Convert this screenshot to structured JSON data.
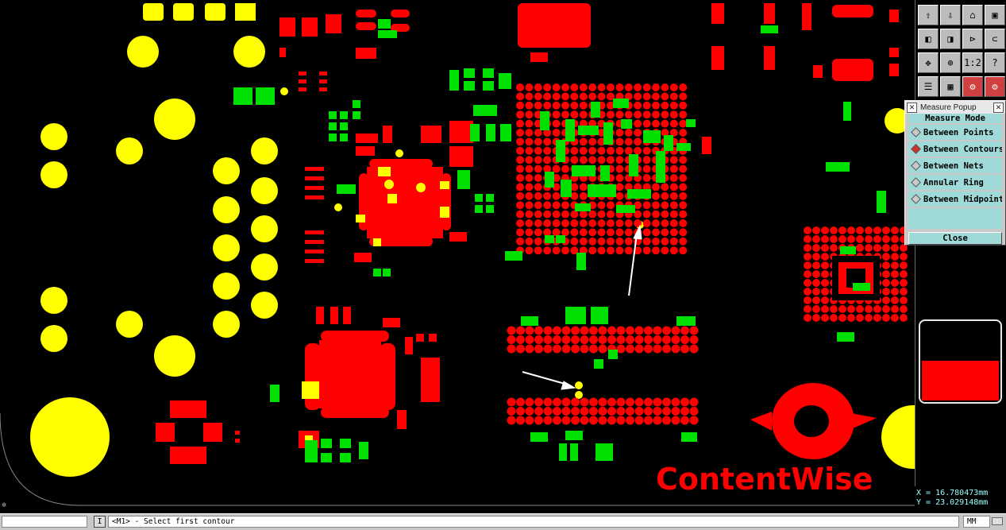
{
  "board": {
    "logo_text": "ContentWise",
    "colors": {
      "copper": "#ff0000",
      "pad": "#ffff00",
      "selected": "#00e000",
      "background": "#000000"
    }
  },
  "toolbar": {
    "buttons": [
      {
        "name": "layer-up-icon",
        "glyph": "⇧"
      },
      {
        "name": "layer-down-icon",
        "glyph": "⇩"
      },
      {
        "name": "home-icon",
        "glyph": "⌂"
      },
      {
        "name": "window-icon",
        "glyph": "▣"
      },
      {
        "name": "pan-left-icon",
        "glyph": "◧"
      },
      {
        "name": "pan-right-icon",
        "glyph": "◨"
      },
      {
        "name": "zoom-in-icon",
        "glyph": "⊳"
      },
      {
        "name": "step-icon",
        "glyph": "⊂"
      },
      {
        "name": "zoom-fit-icon",
        "glyph": "✥"
      },
      {
        "name": "zoom-center-icon",
        "glyph": "⊕"
      },
      {
        "name": "scale-icon",
        "glyph": "1:2"
      },
      {
        "name": "help-icon",
        "glyph": "?"
      },
      {
        "name": "layers-icon",
        "glyph": "☰"
      },
      {
        "name": "grid-icon",
        "glyph": "▦"
      },
      {
        "name": "net-icon",
        "glyph": "⚙"
      },
      {
        "name": "component-icon",
        "glyph": "⚙"
      }
    ]
  },
  "measure_popup": {
    "title": "Measure Popup",
    "header": "Measure Mode",
    "options": [
      {
        "label": "Between Points",
        "selected": false
      },
      {
        "label": "Between Contours",
        "selected": true
      },
      {
        "label": "Between Nets",
        "selected": false
      },
      {
        "label": "Annular Ring",
        "selected": false
      },
      {
        "label": "Between Midpoints",
        "selected": false
      }
    ],
    "close_label": "Close"
  },
  "coordinates": {
    "x": "X = 16.780473mm",
    "y": "Y = 23.029148mm"
  },
  "statusbar": {
    "info_button": "I",
    "message": "<M1> - Select first contour",
    "units": "MM"
  }
}
